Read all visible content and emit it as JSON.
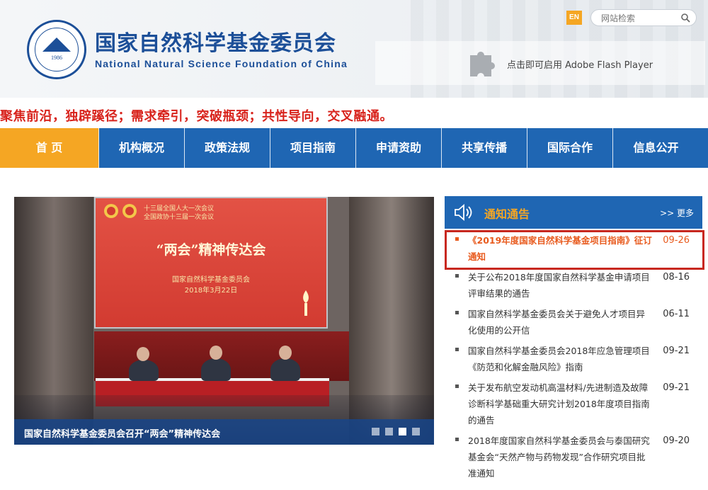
{
  "header": {
    "title_cn": "国家自然科学基金委员会",
    "title_en": "National Natural Science Foundation of China",
    "logo_year": "1986",
    "lang_button": "EN",
    "search_placeholder": "网站检索",
    "flash_text": "点击即可启用 Adobe Flash Player"
  },
  "slogan": "聚焦前沿，独辟蹊径；需求牵引，突破瓶颈；共性导向，交叉融通。",
  "nav": {
    "items": [
      "首 页",
      "机构概况",
      "政策法规",
      "项目指南",
      "申请资助",
      "共享传播",
      "国际合作",
      "信息公开"
    ],
    "active_index": 0
  },
  "slideshow": {
    "banner_line1": "十三届全国人大一次会议",
    "banner_line2": "全国政协十三届一次会议",
    "banner_title": "“两会”精神传达会",
    "banner_org": "国家自然科学基金委员会",
    "banner_date": "2018年3月22日",
    "caption": "国家自然科学基金委员会召开“两会”精神传达会",
    "dot_count": 4,
    "active_dot": 3
  },
  "notices": {
    "title": "通知通告",
    "more": ">> 更多",
    "items": [
      {
        "text": "《2019年度国家自然科学基金项目指南》征订通知",
        "date": "09-26",
        "highlight": true
      },
      {
        "text": "关于公布2018年度国家自然科学基金申请项目评审结果的通告",
        "date": "08-16"
      },
      {
        "text": "国家自然科学基金委员会关于避免人才项目异化使用的公开信",
        "date": "06-11"
      },
      {
        "text": "国家自然科学基金委员会2018年应急管理项目《防范和化解金融风险》指南",
        "date": "09-21"
      },
      {
        "text": "关于发布航空发动机高温材料/先进制造及故障诊断科学基础重大研究计划2018年度项目指南的通告",
        "date": "09-21"
      },
      {
        "text": "2018年度国家自然科学基金委员会与泰国研究基金会“天然产物与药物发现”合作研究项目批准通知",
        "date": "09-20"
      }
    ]
  },
  "colors": {
    "brand_blue": "#1f66b3",
    "accent_orange": "#f5a623",
    "slogan_red": "#d8231c",
    "highlight_orange": "#e85a1d",
    "highlight_box": "#c8281f"
  }
}
